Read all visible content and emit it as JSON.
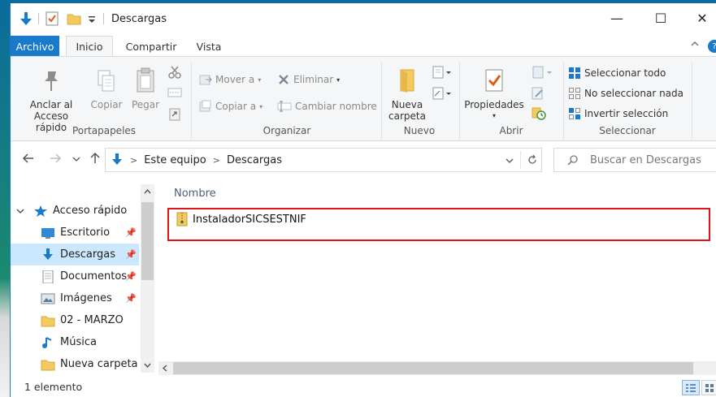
{
  "window": {
    "title": "Descargas",
    "controls": {
      "minimize": "—",
      "maximize": "☐",
      "close": "✕"
    }
  },
  "ribbon_tabs": [
    "Archivo",
    "Inicio",
    "Compartir",
    "Vista"
  ],
  "ribbon": {
    "portapapeles": {
      "label": "Portapapeles",
      "anclar": [
        "Anclar al",
        "Acceso rápido"
      ],
      "copiar": "Copiar",
      "pegar": "Pegar"
    },
    "organizar": {
      "label": "Organizar",
      "mover": "Mover a",
      "copiar_a": "Copiar a",
      "eliminar": "Eliminar",
      "cambiar": "Cambiar nombre"
    },
    "nuevo": {
      "label": "Nuevo",
      "nueva_carpeta": [
        "Nueva",
        "carpeta"
      ]
    },
    "abrir": {
      "label": "Abrir",
      "propiedades": "Propiedades"
    },
    "seleccionar": {
      "label": "Seleccionar",
      "todo": "Seleccionar todo",
      "nada": "No seleccionar nada",
      "invertir": "Invertir selección"
    }
  },
  "address": {
    "crumbs": [
      "Este equipo",
      "Descargas"
    ],
    "search_placeholder": "Buscar en Descargas"
  },
  "nav": {
    "items": [
      {
        "label": "Acceso rápido"
      },
      {
        "label": "Escritorio"
      },
      {
        "label": "Descargas"
      },
      {
        "label": "Documentos"
      },
      {
        "label": "Imágenes"
      },
      {
        "label": "02 - MARZO"
      },
      {
        "label": "Música"
      },
      {
        "label": "Nueva carpeta"
      }
    ]
  },
  "content": {
    "column_header": "Nombre",
    "files": [
      {
        "name": "InstaladorSICSESTNIF"
      }
    ]
  },
  "status": {
    "count_text": "1 elemento"
  },
  "colors": {
    "accent": "#1979ca",
    "selection": "#cce8ff",
    "highlight_border": "#e0141b"
  }
}
